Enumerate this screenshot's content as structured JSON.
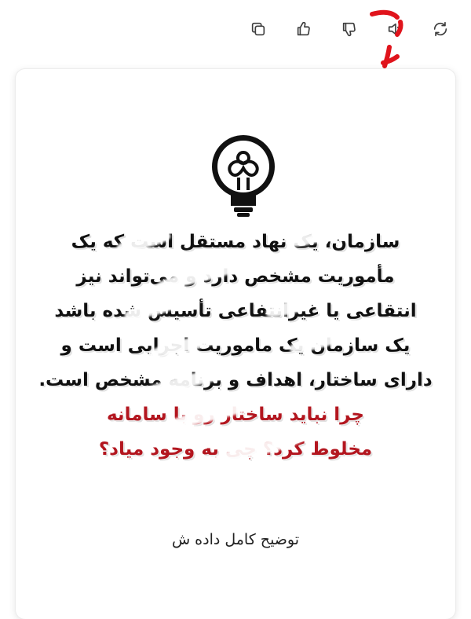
{
  "toolbar": {
    "icons": [
      "refresh-icon",
      "speaker-icon",
      "thumbs-down-icon",
      "thumbs-up-icon",
      "copy-icon"
    ]
  },
  "poster": {
    "lines": [
      "سازمان، یک نهاد مستقل است که یک",
      "مأموریت مشخص دارد و می‌تواند نیز",
      "انتقاعی یا غیرانتفاعی تأسیس شده باشد",
      "یک سازمان یک ماموریت اجرایی است و",
      "دارای ساختار، اهداف و برنامه مشخص است."
    ],
    "red_lines": [
      "چرا نباید ساختار رو با سامانه",
      "مخلوط کرد؟ چی به وجود میاد؟"
    ]
  },
  "caption": "توضیح کامل داده ش",
  "colors": {
    "accent_red": "#b3161f",
    "mark_red": "#e0141c",
    "icon": "#3d3d3d"
  }
}
